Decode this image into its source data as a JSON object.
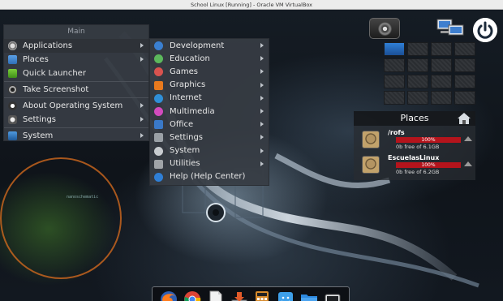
{
  "window": {
    "title": "School Linux [Running] - Oracle VM VirtualBox"
  },
  "desktop": {
    "wallpaper_text": "nanoschematic"
  },
  "main_menu": {
    "header": "Main",
    "items": [
      {
        "label": "Applications",
        "icon": "gear-icon",
        "submenu": true,
        "active": true
      },
      {
        "label": "Places",
        "icon": "folder-icon",
        "submenu": true
      },
      {
        "label": "Quick Launcher",
        "icon": "launcher-icon",
        "submenu": false
      },
      {
        "label": "Take Screenshot",
        "icon": "camera-icon",
        "submenu": false
      },
      {
        "label": "About Operating System",
        "icon": "info-icon",
        "submenu": true
      },
      {
        "label": "Settings",
        "icon": "settings-icon",
        "submenu": true
      },
      {
        "label": "System",
        "icon": "system-icon",
        "submenu": true
      }
    ]
  },
  "applications_menu": {
    "items": [
      {
        "label": "Development",
        "icon": "development-icon",
        "color": "#3a7fd0",
        "submenu": true
      },
      {
        "label": "Education",
        "icon": "education-icon",
        "color": "#5cb85c",
        "submenu": true
      },
      {
        "label": "Games",
        "icon": "games-icon",
        "color": "#d9534f",
        "submenu": true
      },
      {
        "label": "Graphics",
        "icon": "graphics-icon",
        "color": "#e87a1e",
        "submenu": true
      },
      {
        "label": "Internet",
        "icon": "internet-icon",
        "color": "#2f8fd8",
        "submenu": true
      },
      {
        "label": "Multimedia",
        "icon": "multimedia-icon",
        "color": "#d24bbd",
        "submenu": true
      },
      {
        "label": "Office",
        "icon": "office-icon",
        "color": "#3a79c8",
        "submenu": true
      },
      {
        "label": "Settings",
        "icon": "settings-icon",
        "color": "#9aa0a6",
        "submenu": true
      },
      {
        "label": "System",
        "icon": "system-icon",
        "color": "#c8ccd0",
        "submenu": true
      },
      {
        "label": "Utilities",
        "icon": "utilities-icon",
        "color": "#a0a4a8",
        "submenu": true
      },
      {
        "label": "Help (Help Center)",
        "icon": "help-icon",
        "color": "#2f7fd6",
        "submenu": false
      }
    ]
  },
  "places_widget": {
    "title": "Places",
    "drives": [
      {
        "name": "/rofs",
        "usage": "100%",
        "free": "0b free of 6.1GB"
      },
      {
        "name": "EscuelasLinux",
        "usage": "100%",
        "free": "0b free of 6.2GB"
      }
    ]
  },
  "workspaces": {
    "count": 16,
    "current": 1
  },
  "dock": {
    "items": [
      {
        "name": "firefox-icon"
      },
      {
        "name": "chrome-icon"
      },
      {
        "name": "text-editor-icon"
      },
      {
        "name": "downloads-icon"
      },
      {
        "name": "calculator-icon"
      },
      {
        "name": "finder-icon"
      },
      {
        "name": "folder-icon"
      },
      {
        "name": "drive-icon"
      }
    ]
  }
}
